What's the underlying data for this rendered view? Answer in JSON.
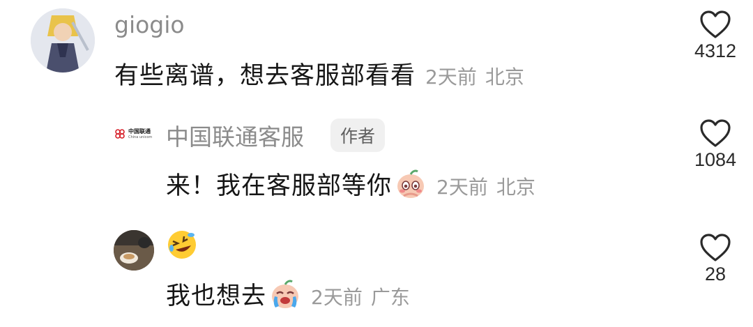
{
  "comments": [
    {
      "author": "giogio",
      "text": "有些离谱，想去客服部看看",
      "time": "2天前",
      "location": "北京",
      "likes": "4312"
    },
    {
      "author": "中国联通客服",
      "badge": "作者",
      "logo_text": "中国联通",
      "logo_subtext": "China unicom",
      "text": "来！我在客服部等你",
      "time": "2天前",
      "location": "北京",
      "likes": "1084"
    },
    {
      "author": "🤣",
      "text": "我也想去",
      "time": "2天前",
      "location": "广东",
      "likes": "28"
    }
  ],
  "colors": {
    "text": "#161616",
    "meta": "#9a9a9a",
    "unicom_red": "#d7212a"
  },
  "icons": [
    "heart-outline-icon",
    "shy-emoji-icon",
    "crying-emoji-icon",
    "laughing-face-icon"
  ]
}
